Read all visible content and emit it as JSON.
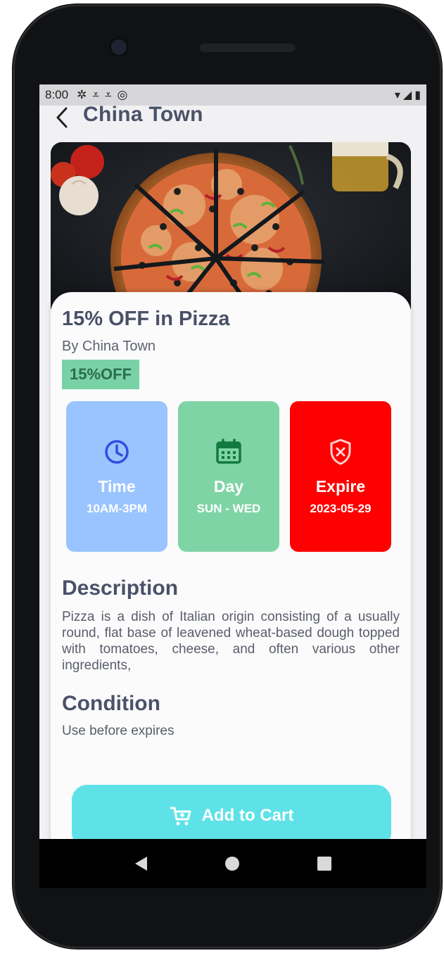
{
  "status_bar": {
    "time": "8:00"
  },
  "header": {
    "title": "China Town"
  },
  "offer": {
    "title": "15% OFF in Pizza",
    "by": "By China Town",
    "badge": "15%OFF"
  },
  "info_tiles": [
    {
      "label": "Time",
      "value": "10AM-3PM",
      "color": "#9ac4ff",
      "icon": "clock-icon"
    },
    {
      "label": "Day",
      "value": "SUN - WED",
      "color": "#7fd4a5",
      "icon": "calendar-icon"
    },
    {
      "label": "Expire",
      "value": "2023-05-29",
      "color": "#fe0000",
      "icon": "shield-x-icon"
    }
  ],
  "description": {
    "title": "Description",
    "text": "Pizza is a dish of Italian origin consisting of a usually round, flat base of leavened wheat-based dough topped with tomatoes, cheese, and often various other ingredients,"
  },
  "condition": {
    "title": "Condition",
    "text": "Use before expires"
  },
  "cart_button": {
    "label": "Add to Cart",
    "color": "#5fe2e7"
  },
  "colors": {
    "title_text": "#4a5268",
    "badge_bg": "#78d2a6"
  }
}
